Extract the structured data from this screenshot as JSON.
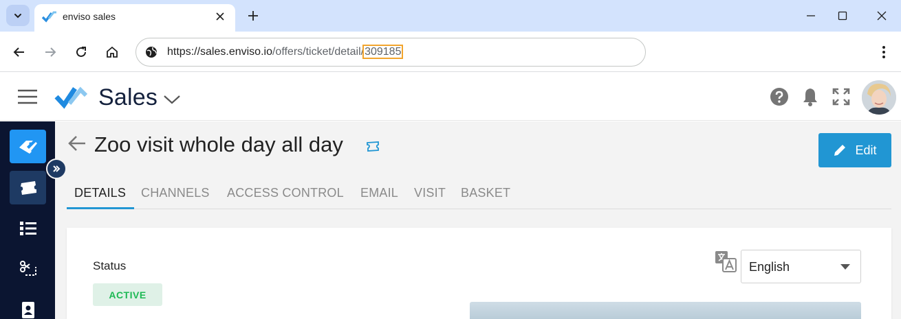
{
  "browser": {
    "tab_title": "enviso sales",
    "url_host": "https://sales.enviso.io",
    "url_path": "/offers/ticket/detail/",
    "url_highlight": "309185"
  },
  "app": {
    "name": "Sales",
    "brand_color": "#2196d3",
    "sidebar_color": "#0b1531"
  },
  "page": {
    "title": "Zoo visit whole day all day",
    "edit_label": "Edit",
    "tabs": [
      {
        "label": "DETAILS",
        "active": true
      },
      {
        "label": "CHANNELS",
        "active": false
      },
      {
        "label": "ACCESS CONTROL",
        "active": false
      },
      {
        "label": "EMAIL",
        "active": false
      },
      {
        "label": "VISIT",
        "active": false
      },
      {
        "label": "BASKET",
        "active": false
      }
    ]
  },
  "details": {
    "status_label": "Status",
    "status_value": "ACTIVE",
    "language": "English"
  },
  "sidebar": {
    "items": [
      {
        "icon": "tag-icon",
        "active": true
      },
      {
        "icon": "ticket-icon",
        "active": true
      },
      {
        "icon": "list-icon",
        "active": false
      },
      {
        "icon": "scissors-icon",
        "active": false
      },
      {
        "icon": "contacts-icon",
        "active": false
      }
    ]
  }
}
